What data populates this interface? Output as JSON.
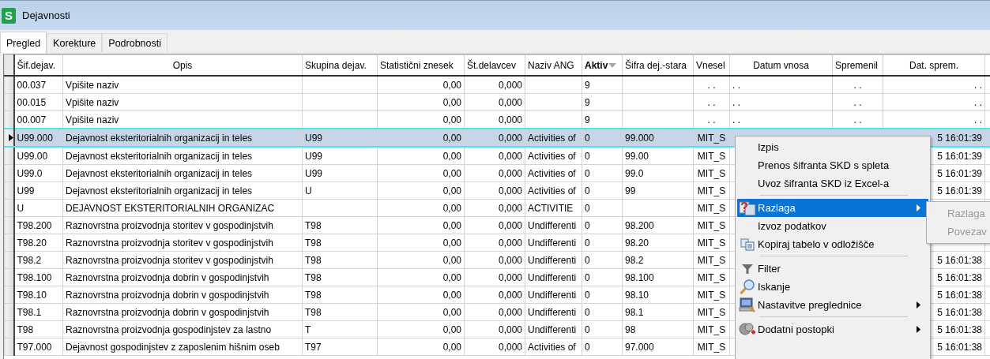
{
  "window": {
    "logo": "S",
    "title": "Dejavnosti"
  },
  "tabs": [
    {
      "label": "Pregled",
      "selected": true
    },
    {
      "label": "Korekture",
      "selected": false
    },
    {
      "label": "Podrobnosti",
      "selected": false
    }
  ],
  "table": {
    "columns": [
      {
        "label": "Šif.dejav.",
        "sorted": false
      },
      {
        "label": "Opis",
        "sorted": false
      },
      {
        "label": "Skupina dejav.",
        "sorted": false
      },
      {
        "label": "Statistični znesek",
        "sorted": false
      },
      {
        "label": "Št.delavcev",
        "sorted": false
      },
      {
        "label": "Naziv ANG",
        "sorted": false
      },
      {
        "label": "Aktiv",
        "sorted": true
      },
      {
        "label": "Šifra dej.-stara",
        "sorted": false
      },
      {
        "label": "Vnesel",
        "sorted": false
      },
      {
        "label": "Datum vnosa",
        "sorted": false
      },
      {
        "label": "Spremenil",
        "sorted": false
      },
      {
        "label": "Dat. sprem.",
        "sorted": false
      }
    ],
    "rows": [
      {
        "selected": false,
        "cells": [
          "00.037",
          "Vpišite naziv",
          null,
          "0,00",
          "0,000",
          null,
          "9",
          null,
          ". .",
          ". .",
          ". .",
          ". ."
        ]
      },
      {
        "selected": false,
        "cells": [
          "00.015",
          "Vpišite naziv",
          null,
          "0,00",
          "0,000",
          null,
          "9",
          null,
          ". .",
          ". .",
          ". .",
          ". ."
        ]
      },
      {
        "selected": false,
        "cells": [
          "00.007",
          "Vpišite naziv",
          null,
          "0,00",
          "0,000",
          null,
          "9",
          null,
          ". .",
          ". .",
          ". .",
          ". ."
        ]
      },
      {
        "selected": true,
        "cells": [
          "U99.000",
          "Dejavnost eksteritorialnih organizacij in teles",
          "U99",
          "0,00",
          "0,000",
          "Activities of",
          "0",
          "99.000",
          "MIT_S",
          null,
          null,
          "5 16:01:39"
        ]
      },
      {
        "selected": false,
        "cells": [
          "U99.00",
          "Dejavnost eksteritorialnih organizacij in teles",
          "U99",
          "0,00",
          "0,000",
          "Activities of",
          "0",
          "99.00",
          "MIT_S",
          null,
          null,
          "5 16:01:39"
        ]
      },
      {
        "selected": false,
        "cells": [
          "U99.0",
          "Dejavnost eksteritorialnih organizacij in teles",
          "U99",
          "0,00",
          "0,000",
          "Activities of",
          "0",
          "99.0",
          "MIT_S",
          null,
          null,
          "5 16:01:39"
        ]
      },
      {
        "selected": false,
        "cells": [
          "U99",
          "Dejavnost eksteritorialnih organizacij in teles",
          "U",
          "0,00",
          "0,000",
          "Activities of",
          "0",
          "99",
          "MIT_S",
          null,
          null,
          "5 16:01:39"
        ]
      },
      {
        "selected": false,
        "cells": [
          "U",
          "DEJAVNOST EKSTERITORIALNIH ORGANIZAC",
          null,
          "0,00",
          "0,000",
          "ACTIVITIE",
          "0",
          null,
          "MIT_S",
          null,
          null,
          null
        ]
      },
      {
        "selected": false,
        "cells": [
          "T98.200",
          "Raznovrstna proizvodnja storitev v gospodinjstvih",
          "T98",
          "0,00",
          "0,000",
          "Undifferenti",
          "0",
          "98.200",
          "MIT_S",
          null,
          null,
          null
        ]
      },
      {
        "selected": false,
        "cells": [
          "T98.20",
          "Raznovrstna proizvodnja storitev v gospodinjstvih",
          "T98",
          "0,00",
          "0,000",
          "Undifferenti",
          "0",
          "98.20",
          "MIT_S",
          null,
          null,
          null
        ]
      },
      {
        "selected": false,
        "cells": [
          "T98.2",
          "Raznovrstna proizvodnja storitev v gospodinjstvih",
          "T98",
          "0,00",
          "0,000",
          "Undifferenti",
          "0",
          "98.2",
          "MIT_S",
          null,
          null,
          "5 16:01:38"
        ]
      },
      {
        "selected": false,
        "cells": [
          "T98.100",
          "Raznovrstna proizvodnja dobrin v gospodinjstvih",
          "T98",
          "0,00",
          "0,000",
          "Undifferenti",
          "0",
          "98.100",
          "MIT_S",
          null,
          null,
          "5 16:01:38"
        ]
      },
      {
        "selected": false,
        "cells": [
          "T98.10",
          "Raznovrstna proizvodnja dobrin v gospodinjstvih",
          "T98",
          "0,00",
          "0,000",
          "Undifferenti",
          "0",
          "98.10",
          "MIT_S",
          null,
          null,
          "5 16:01:38"
        ]
      },
      {
        "selected": false,
        "cells": [
          "T98.1",
          "Raznovrstna proizvodnja dobrin v gospodinjstvih",
          "T98",
          "0,00",
          "0,000",
          "Undifferenti",
          "0",
          "98.1",
          "MIT_S",
          null,
          null,
          "5 16:01:38"
        ]
      },
      {
        "selected": false,
        "cells": [
          "T98",
          "Raznovrstna proizvodnja gospodinjstev za lastno",
          "T",
          "0,00",
          "0,000",
          "Undifferenti",
          "0",
          "98",
          "MIT_S",
          null,
          null,
          "5 16:01:38"
        ]
      },
      {
        "selected": false,
        "cells": [
          "T97.000",
          "Dejavnost gospodinjstev z zaposlenim hišnim oseb",
          "T97",
          "0,00",
          "0,000",
          "Activities of",
          "0",
          "97.000",
          "MIT_S",
          null,
          null,
          "5 16:01:38"
        ]
      }
    ]
  },
  "context_menu": {
    "items": [
      {
        "kind": "item",
        "label": "Izpis",
        "selected": false,
        "submenu": false
      },
      {
        "kind": "item",
        "label": "Prenos šifranta SKD s spleta",
        "selected": false,
        "submenu": false
      },
      {
        "kind": "item",
        "label": "Uvoz šifranta SKD iz Excel-a",
        "selected": false,
        "submenu": false
      },
      {
        "kind": "separator"
      },
      {
        "kind": "item",
        "label": "Razlaga",
        "selected": true,
        "submenu": true
      },
      {
        "kind": "item",
        "label": "Izvoz podatkov",
        "selected": false,
        "submenu": false
      },
      {
        "kind": "item",
        "label": "Kopiraj tabelo v odložišče",
        "selected": false,
        "submenu": false
      },
      {
        "kind": "separator"
      },
      {
        "kind": "item",
        "label": "Filter",
        "selected": false,
        "submenu": false
      },
      {
        "kind": "item",
        "label": "Iskanje",
        "selected": false,
        "submenu": false
      },
      {
        "kind": "item",
        "label": "Nastavitve preglednice",
        "selected": false,
        "submenu": true
      },
      {
        "kind": "separator"
      },
      {
        "kind": "item",
        "label": "Dodatni postopki",
        "selected": false,
        "submenu": true
      }
    ]
  },
  "submenu": {
    "items": [
      {
        "label": "Razlaga",
        "disabled": true
      },
      {
        "label": "Povezav",
        "disabled": true
      }
    ]
  }
}
